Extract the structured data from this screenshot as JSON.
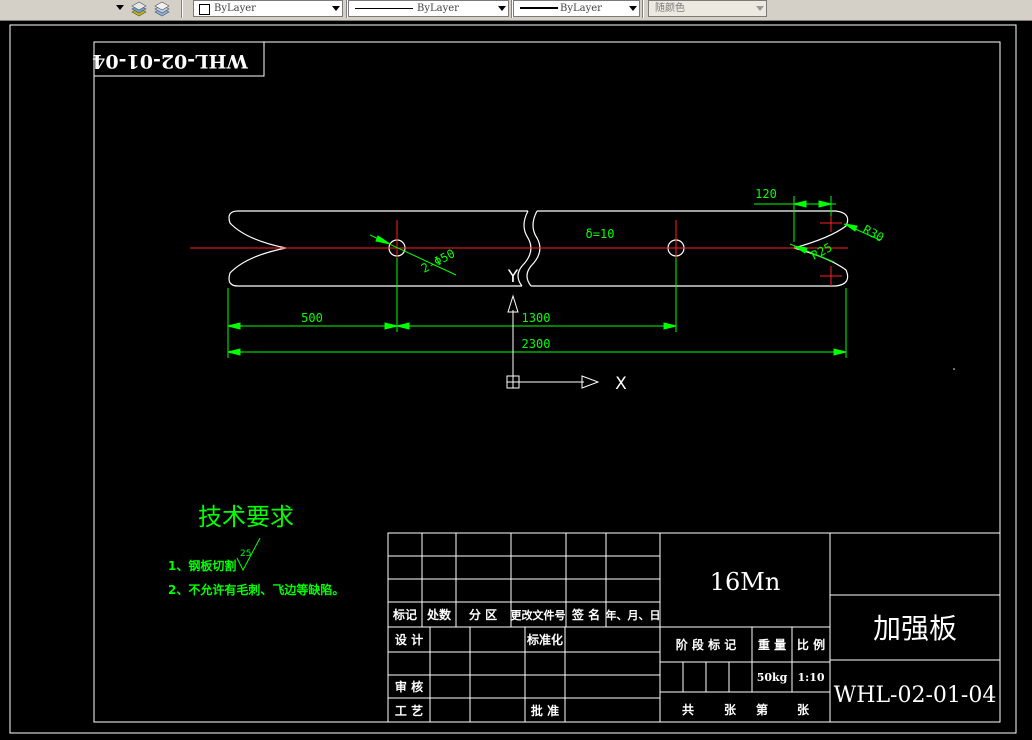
{
  "toolbar": {
    "layer_icon_1": "layer-stack-icon",
    "layer_icon_2": "layer-states-icon",
    "color_value": "ByLayer",
    "linetype_value": "ByLayer",
    "lineweight_value": "ByLayer",
    "plotstyle_value": "随颜色"
  },
  "drawing": {
    "header_code": "WHL-02-01-04",
    "thickness": "δ=10",
    "holes": "2-Φ50",
    "dim_500": "500",
    "dim_1300": "1300",
    "dim_2300": "2300",
    "dim_120": "120",
    "radius_r30": "R30",
    "radius_r25": "R25",
    "axis_x": "X",
    "axis_y": "Y",
    "tech_title": "技术要求",
    "tech_note_1": "1、钢板切割",
    "roughness": "25",
    "tech_note_2": "2、不允许有毛刺、飞边等缺陷。"
  },
  "title_block": {
    "material": "16Mn",
    "part_name": "加强板",
    "drawing_no": "WHL-02-01-04",
    "rev_mark": "标记",
    "rev_count": "处数",
    "rev_zone": "分 区",
    "rev_doc": "更改文件号",
    "rev_sign": "签 名",
    "rev_date": "年、月、日",
    "design": "设 计",
    "standardize": "标准化",
    "stage_mark": "阶 段 标 记",
    "weight_label": "重 量",
    "scale_label": "比 例",
    "weight_value": "50kg",
    "scale_value": "1:10",
    "review": "审 核",
    "process": "工 艺",
    "approve": "批 准",
    "sheets_total": "共",
    "sheets_unit1": "张",
    "sheet_no": "第",
    "sheets_unit2": "张"
  }
}
